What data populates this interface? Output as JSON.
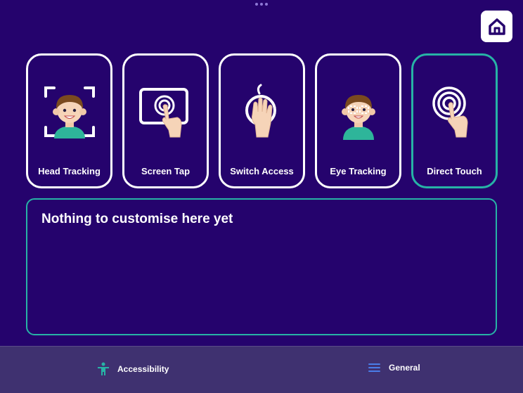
{
  "colors": {
    "background": "#25036d",
    "accent_teal": "#27b3a6",
    "card_border": "#ffffff",
    "bottom_bar": "#3f3170",
    "tab_icon_blue": "#4a7de8"
  },
  "header": {
    "home_icon": "home-icon"
  },
  "modes": [
    {
      "label": "Head Tracking",
      "icon": "head-tracking-icon",
      "selected": false
    },
    {
      "label": "Screen Tap",
      "icon": "screen-tap-icon",
      "selected": false
    },
    {
      "label": "Switch Access",
      "icon": "switch-access-icon",
      "selected": false
    },
    {
      "label": "Eye Tracking",
      "icon": "eye-tracking-icon",
      "selected": false
    },
    {
      "label": "Direct Touch",
      "icon": "direct-touch-icon",
      "selected": true
    }
  ],
  "panel": {
    "title": "Nothing to customise here yet"
  },
  "bottom_tabs": [
    {
      "label": "Accessibility",
      "icon": "accessibility-person-icon"
    },
    {
      "label": "General",
      "icon": "menu-lines-icon"
    }
  ]
}
